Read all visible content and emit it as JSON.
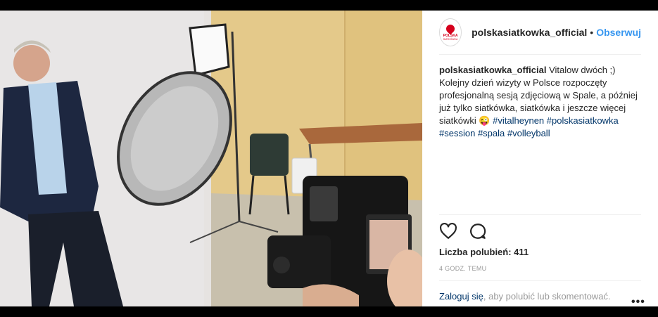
{
  "post": {
    "username": "polskasiatkowka_official",
    "separator": "•",
    "follow_label": "Obserwuj",
    "avatar": {
      "icon": "polska-siatkowka-logo",
      "line1": "POLSKA",
      "line2": "SIATKÓWKA"
    },
    "caption": {
      "username": "polskasiatkowka_official",
      "text": " Vitalow dwóch ;) Kolejny dzień wizyty w Polsce rozpoczęty profesjonalną sesją zdjęciową w Spale, a później już tylko siatkówka, siatkówka i jeszcze więcej siatkówki 😜 ",
      "tags": [
        "#vitalheynen",
        "#polskasiatkowka",
        "#session",
        "#spala",
        "#volleyball"
      ]
    },
    "actions": {
      "like_icon": "heart-icon",
      "comment_icon": "comment-icon"
    },
    "likes_label": "Liczba polubień: 411",
    "time_label": "4 GODZ. TEMU",
    "footer": {
      "login": "Zaloguj się",
      "rest": ", aby polubić lub skomentować."
    },
    "more_label": "•••"
  },
  "colors": {
    "link": "#3897f0",
    "hashtag": "#003569",
    "text": "#262626",
    "muted": "#999999"
  }
}
